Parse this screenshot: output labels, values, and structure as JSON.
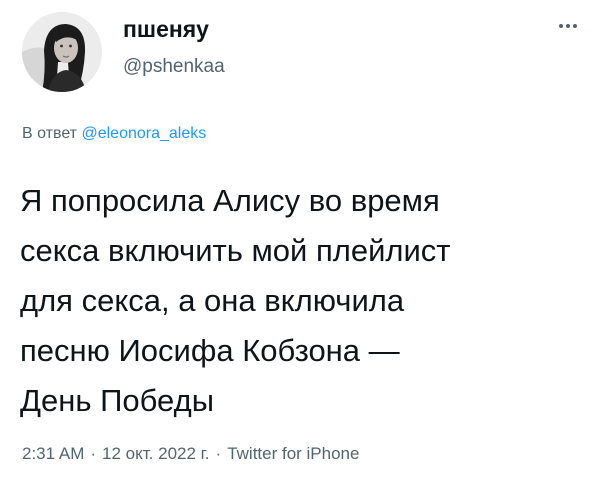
{
  "user": {
    "display_name": "пшеняу",
    "handle": "@pshenkaa"
  },
  "icons": {
    "more": "more-horizontal-icon",
    "avatar": "profile-photo"
  },
  "reply": {
    "prefix": "В ответ",
    "to_handle": "@eleonora_aleks"
  },
  "tweet": {
    "text": "Я попросила Алису во время\nсекса включить мой плейлист\nдля секса, а она включила\nпесню Иосифа Кобзона —\nДень Победы"
  },
  "meta": {
    "time": "2:31 AM",
    "separator": "·",
    "date": "12 окт. 2022 г.",
    "source": "Twitter for iPhone"
  },
  "colors": {
    "text": "#0f1419",
    "secondary": "#536471",
    "link": "#1d9bf0"
  }
}
